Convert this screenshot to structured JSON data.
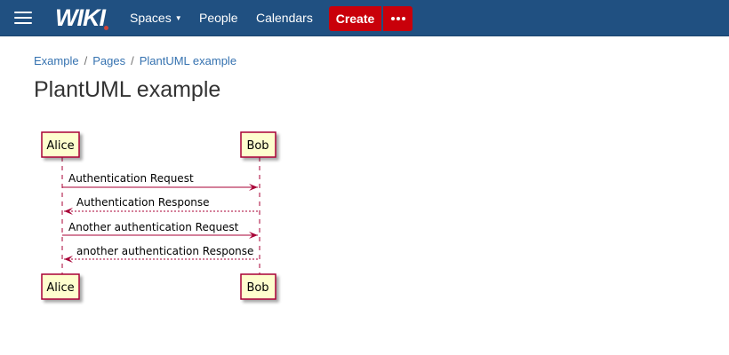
{
  "header": {
    "logo": "WIKI",
    "nav": {
      "spaces": "Spaces",
      "people": "People",
      "calendars": "Calendars"
    },
    "create_label": "Create"
  },
  "breadcrumb": [
    "Example",
    "Pages",
    "PlantUML example"
  ],
  "page": {
    "title": "PlantUML example"
  },
  "sequence_diagram": {
    "participants": [
      "Alice",
      "Bob"
    ],
    "messages": [
      {
        "from": "Alice",
        "to": "Bob",
        "text": "Authentication Request",
        "style": "solid"
      },
      {
        "from": "Bob",
        "to": "Alice",
        "text": "Authentication Response",
        "style": "dashed"
      },
      {
        "from": "Alice",
        "to": "Bob",
        "text": "Another authentication Request",
        "style": "solid"
      },
      {
        "from": "Bob",
        "to": "Alice",
        "text": "another authentication Response",
        "style": "dashed"
      }
    ],
    "colors": {
      "participant_fill": "#fefece",
      "participant_border": "#a80036",
      "line": "#a80036"
    }
  }
}
